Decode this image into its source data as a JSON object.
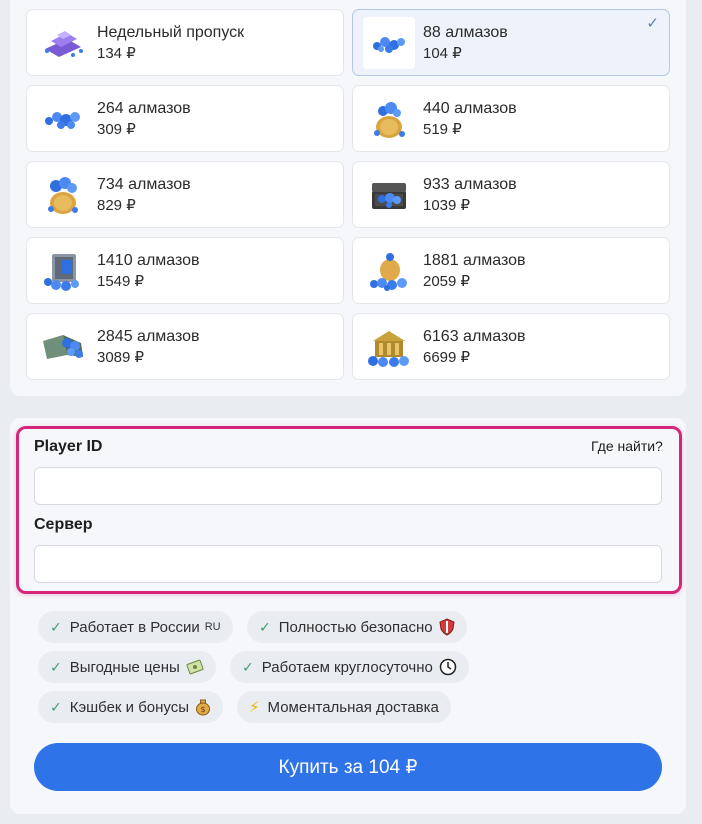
{
  "products": [
    {
      "title": "Недельный пропуск",
      "price": "134 ₽",
      "icon": "weekly-pass-icon",
      "selected": false
    },
    {
      "title": "88 алмазов",
      "price": "104 ₽",
      "icon": "diamonds-pile-small-icon",
      "selected": true
    },
    {
      "title": "264 алмазов",
      "price": "309 ₽",
      "icon": "diamonds-pile-icon",
      "selected": false
    },
    {
      "title": "440 алмазов",
      "price": "519 ₽",
      "icon": "diamond-bag-icon",
      "selected": false
    },
    {
      "title": "734 алмазов",
      "price": "829 ₽",
      "icon": "diamond-bag-icon",
      "selected": false
    },
    {
      "title": "933 алмазов",
      "price": "1039 ₽",
      "icon": "diamond-chest-icon",
      "selected": false
    },
    {
      "title": "1410 алмазов",
      "price": "1549 ₽",
      "icon": "diamond-safe-icon",
      "selected": false
    },
    {
      "title": "1881 алмазов",
      "price": "2059 ₽",
      "icon": "diamond-sack-icon",
      "selected": false
    },
    {
      "title": "2845 алмазов",
      "price": "3089 ₽",
      "icon": "diamond-cart-icon",
      "selected": false
    },
    {
      "title": "6163 алмазов",
      "price": "6699 ₽",
      "icon": "diamond-vault-icon",
      "selected": false
    }
  ],
  "form": {
    "player_id_label": "Player ID",
    "help_link": "Где найти?",
    "player_id_value": "",
    "server_label": "Сервер",
    "server_value": ""
  },
  "features": [
    {
      "text": "Работает в России",
      "prefix": "check-icon",
      "suffix": "RU"
    },
    {
      "text": "Полностью безопасно",
      "prefix": "check-icon",
      "suffix": "shield-icon"
    },
    {
      "text": "Выгодные цены",
      "prefix": "check-icon",
      "suffix": "money-icon"
    },
    {
      "text": "Работаем круглосуточно",
      "prefix": "check-icon",
      "suffix": "clock-icon"
    },
    {
      "text": "Кэшбек и бонусы",
      "prefix": "check-icon",
      "suffix": "money-bag-icon"
    },
    {
      "text": "Моментальная доставка",
      "prefix": "lightning-icon",
      "suffix": ""
    }
  ],
  "buy_button": "Купить за 104 ₽",
  "colors": {
    "accent": "#2f73e8",
    "highlight_border": "#d6267a",
    "check": "#3aa068",
    "diamond": "#2f6fe0"
  }
}
